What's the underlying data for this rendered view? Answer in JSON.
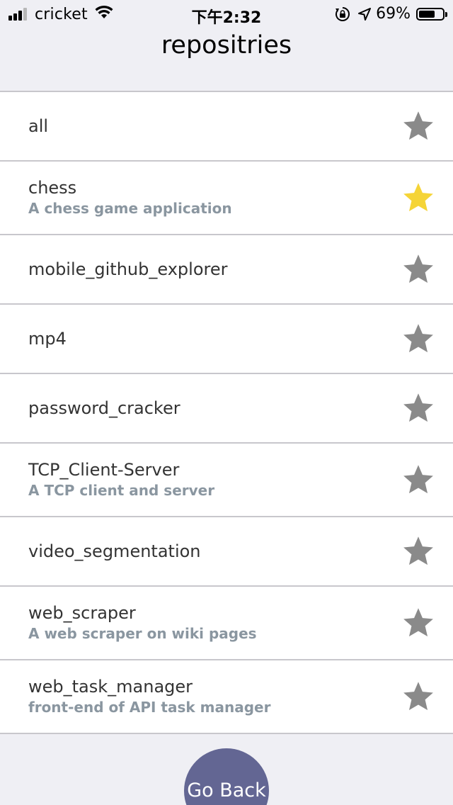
{
  "status_bar": {
    "carrier": "cricket",
    "time": "下午2:32",
    "battery_percent": "69%",
    "battery_level": 0.69,
    "icons": [
      "signal-icon",
      "wifi-icon",
      "orientation-lock-icon",
      "location-arrow-icon",
      "battery-icon"
    ]
  },
  "nav": {
    "title": "repositries"
  },
  "colors": {
    "background": "#efeff4",
    "separator": "#c8c7cc",
    "name_text": "#333333",
    "desc_text": "#8a96a0",
    "star_default": "#8a8a8a",
    "star_active": "#f5d437",
    "button": "#636693"
  },
  "repos": [
    {
      "name": "all",
      "description": "",
      "starred": false
    },
    {
      "name": "chess",
      "description": "A chess game application",
      "starred": true
    },
    {
      "name": "mobile_github_explorer",
      "description": "",
      "starred": false
    },
    {
      "name": "mp4",
      "description": "",
      "starred": false
    },
    {
      "name": "password_cracker",
      "description": "",
      "starred": false
    },
    {
      "name": "TCP_Client-Server",
      "description": "A TCP client and server",
      "starred": false
    },
    {
      "name": "video_segmentation",
      "description": "",
      "starred": false
    },
    {
      "name": "web_scraper",
      "description": "A web scraper on wiki pages",
      "starred": false
    },
    {
      "name": "web_task_manager",
      "description": "front-end of API task manager",
      "starred": false
    }
  ],
  "go_back_label": "Go Back"
}
